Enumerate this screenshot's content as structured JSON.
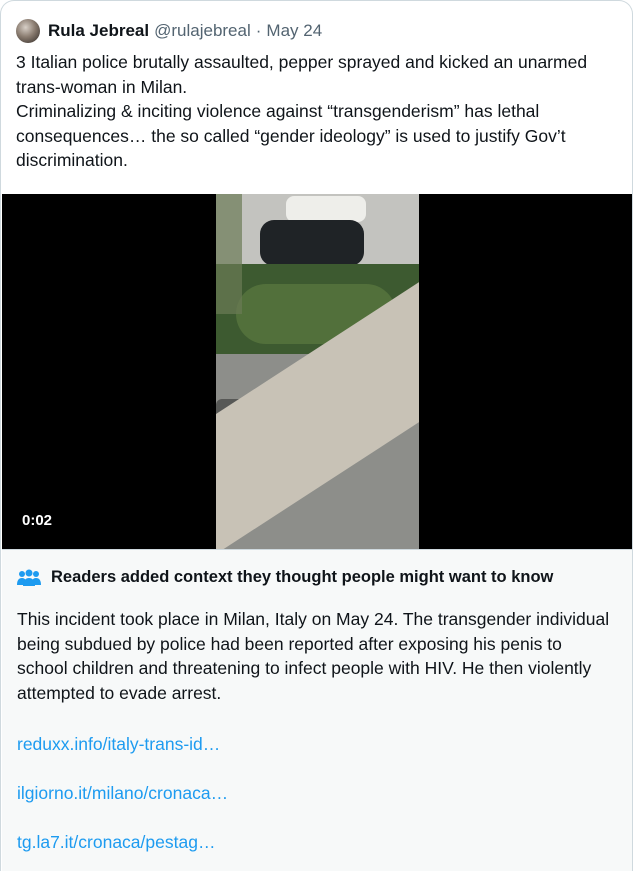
{
  "tweet": {
    "author_name": "Rula Jebreal",
    "handle": "@rulajebreal",
    "separator": "·",
    "date": "May 24",
    "text_lines": [
      "3 Italian police brutally assaulted, pepper sprayed and kicked an unarmed trans-woman in Milan.",
      "Criminalizing & inciting violence against “transgenderism” has lethal consequences… the so called “gender ideology” is used to justify Gov’t discrimination."
    ]
  },
  "video": {
    "timestamp": "0:02"
  },
  "community_note": {
    "icon": "people-icon",
    "title": "Readers added context they thought people might want to know",
    "body": "This incident took place in Milan, Italy on May 24. The transgender individual being subdued by police had been reported after exposing his penis to school children and threatening to infect people with HIV. He then violently attempted to evade arrest.",
    "links": [
      "reduxx.info/italy-trans-id…",
      "ilgiorno.it/milano/cronaca…",
      "tg.la7.it/cronaca/pestag…"
    ]
  },
  "colors": {
    "text": "#0f1419",
    "secondary": "#536471",
    "link": "#1d9bf0",
    "note_bg": "#f7f9f9",
    "border": "#cfd9de"
  }
}
